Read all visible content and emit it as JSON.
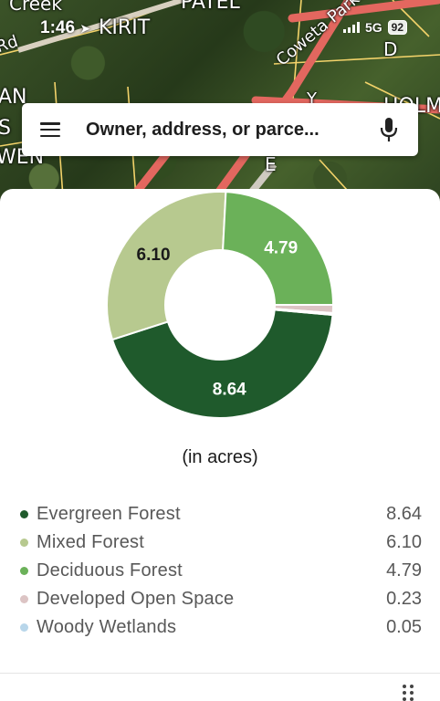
{
  "status_bar": {
    "time": "1:46",
    "network": "5G",
    "battery": "92"
  },
  "map": {
    "labels": {
      "creek": "Creek",
      "patel": "PATEL",
      "rd": "Rd",
      "kirit": "KIRIT",
      "parkway": "Coweta Parkway",
      "d": "D",
      "an": "AN",
      "s": "S",
      "wen": "WEN",
      "holm": "HOLM",
      "e": "E",
      "y": "Y"
    }
  },
  "search": {
    "placeholder": "Owner, address, or parce..."
  },
  "chart_data": {
    "type": "pie",
    "variant": "donut",
    "unit_caption": "(in acres)",
    "slices": [
      {
        "label": "Evergreen Forest",
        "value": 8.64,
        "display": "8.64",
        "color": "#1f5a2c"
      },
      {
        "label": "Mixed Forest",
        "value": 6.1,
        "display": "6.10",
        "color": "#b7c98f"
      },
      {
        "label": "Deciduous Forest",
        "value": 4.79,
        "display": "4.79",
        "color": "#6bb159"
      },
      {
        "label": "Developed Open Space",
        "value": 0.23,
        "display": "0.23",
        "color": "#dcc4c4"
      },
      {
        "label": "Woody Wetlands",
        "value": 0.05,
        "display": "0.05",
        "color": "#b8d6ea"
      }
    ]
  },
  "legend": {
    "items": [
      {
        "label": "Evergreen Forest",
        "value": "8.64",
        "color": "#1f5a2c"
      },
      {
        "label": "Mixed Forest",
        "value": "6.10",
        "color": "#b7c98f"
      },
      {
        "label": "Deciduous Forest",
        "value": "4.79",
        "color": "#6bb159"
      },
      {
        "label": "Developed Open Space",
        "value": "0.23",
        "color": "#dcc4c4"
      },
      {
        "label": "Woody Wetlands",
        "value": "0.05",
        "color": "#b8d6ea"
      }
    ]
  },
  "icons": {
    "menu": "menu-icon",
    "mic": "microphone-icon",
    "grip": "drag-handle-icon",
    "location": "location-arrow-icon"
  }
}
